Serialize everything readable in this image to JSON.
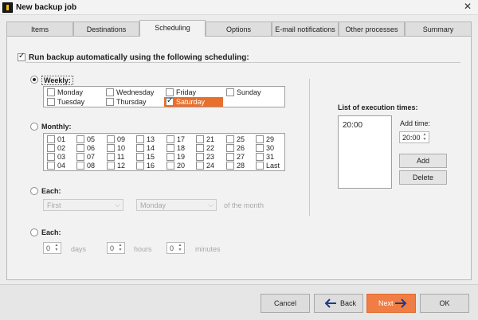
{
  "window": {
    "title": "New backup job"
  },
  "tabs": [
    "Items",
    "Destinations",
    "Scheduling",
    "Options",
    "E-mail notifications",
    "Other processes",
    "Summary"
  ],
  "active_tab": "Scheduling",
  "main_option": {
    "label": "Run backup automatically using the following scheduling:",
    "checked": true
  },
  "weekly": {
    "label": "Weekly:",
    "days": [
      "Monday",
      "Wednesday",
      "Friday",
      "Sunday",
      "Tuesday",
      "Thursday",
      "Saturday"
    ],
    "selected": "Saturday"
  },
  "monthly": {
    "label": "Monthly:",
    "days": [
      "01",
      "05",
      "09",
      "13",
      "17",
      "21",
      "25",
      "29",
      "02",
      "06",
      "10",
      "14",
      "18",
      "22",
      "26",
      "30",
      "03",
      "07",
      "11",
      "15",
      "19",
      "23",
      "27",
      "31",
      "04",
      "08",
      "12",
      "16",
      "20",
      "24",
      "28",
      "Last"
    ]
  },
  "each_ordinal": {
    "label": "Each:",
    "ordinal": "First",
    "weekday": "Monday",
    "suffix": "of the month"
  },
  "each_interval": {
    "label": "Each:",
    "days_value": "0",
    "days_label": "days",
    "hours_value": "0",
    "hours_label": "hours",
    "minutes_value": "0",
    "minutes_label": "minutes"
  },
  "execution": {
    "label": "List of execution times:",
    "times": [
      "20:00"
    ],
    "add_time_label": "Add time:",
    "add_time_value": "20:00",
    "add_button": "Add",
    "delete_button": "Delete"
  },
  "footer": {
    "cancel": "Cancel",
    "back": "Back",
    "next": "Next",
    "ok": "OK"
  },
  "colors": {
    "accent": "#E8702D",
    "next_button": "#F07D44"
  }
}
